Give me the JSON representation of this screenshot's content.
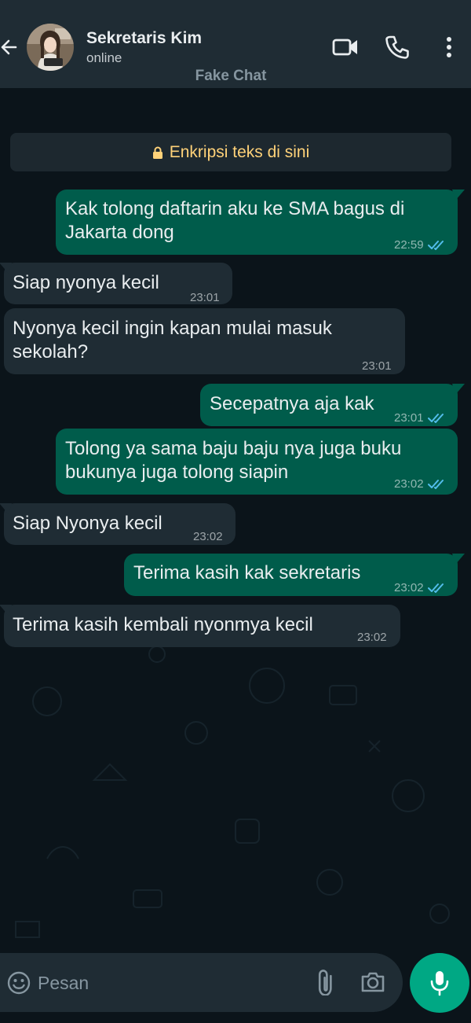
{
  "header": {
    "contact_name": "Sekretaris Kim",
    "contact_status": "online",
    "watermark": "Fake Chat"
  },
  "banner": {
    "text": "Enkripsi teks di sini"
  },
  "messages": [
    {
      "direction": "out",
      "text": "Kak tolong daftarin aku ke SMA bagus di\nJakarta dong",
      "time": "22:59",
      "read": true
    },
    {
      "direction": "in",
      "text": "Siap nyonya kecil",
      "time": "23:01"
    },
    {
      "direction": "in",
      "text": "Nyonya kecil ingin kapan mulai masuk\nsekolah?",
      "time": "23:01"
    },
    {
      "direction": "out",
      "text": "Secepatnya aja kak",
      "time": "23:01",
      "read": true
    },
    {
      "direction": "out",
      "text": "Tolong ya sama baju baju nya juga buku\nbukunya juga tolong siapin",
      "time": "23:02",
      "read": true
    },
    {
      "direction": "in",
      "text": "Siap Nyonya kecil",
      "time": "23:02"
    },
    {
      "direction": "out",
      "text": "Terima kasih kak sekretaris",
      "time": "23:02",
      "read": true
    },
    {
      "direction": "in",
      "text": "Terima kasih kembali nyonmya kecil",
      "time": "23:02"
    }
  ],
  "input": {
    "placeholder": "Pesan"
  },
  "icons": {
    "back": "back-arrow-icon",
    "video": "video-camera-icon",
    "call": "phone-icon",
    "menu": "more-vertical-icon",
    "lock": "lock-icon",
    "emoji": "emoji-icon",
    "attach": "paperclip-icon",
    "camera": "camera-icon",
    "mic": "microphone-icon",
    "read": "double-check-icon"
  },
  "colors": {
    "background": "#0b141a",
    "header": "#1f2c34",
    "outgoing_bubble": "#005c4b",
    "incoming_bubble": "#1f2c34",
    "accent": "#00a884",
    "read_ticks": "#53bdeb",
    "banner_text": "#ffd279"
  }
}
